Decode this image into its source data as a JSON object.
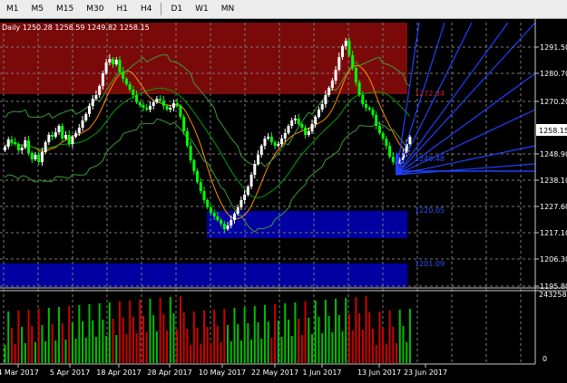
{
  "toolbar": {
    "timeframes": [
      "M1",
      "M5",
      "M15",
      "M30",
      "H1",
      "H4",
      "D1",
      "W1",
      "MN"
    ]
  },
  "chart": {
    "header": "Daily  1250.28 1258.59 1249.82 1258.15",
    "price_axis": [
      "1291.50",
      "1280.70",
      "1270.20",
      "1258.15",
      "1248.90",
      "1238.10",
      "1227.60",
      "1217.10",
      "1206.30",
      "1195.80"
    ],
    "current_price": "1258.15",
    "zone_labels": [
      "1272.84",
      "1249.48",
      "1220.05",
      "1201.09"
    ],
    "volume_axis": [
      "243258",
      "0"
    ],
    "date_axis": [
      "4 Mar 2017",
      "5 Apr 2017",
      "18 Apr 2017",
      "28 Apr 2017",
      "10 May 2017",
      "22 May 2017",
      "1 Jun 2017",
      "13 Jun 2017",
      "23 Jun 2017"
    ],
    "colors": {
      "bull": "#ffffff",
      "bear": "#00ff00",
      "resistance_zone": "#7a0a0a",
      "support_zone": "#0000a0",
      "fan": "#2040ff",
      "ma_fast": "#ff8c00",
      "ma_slow": "#00a000",
      "bands": "#3c9a3c",
      "vol_up": "#00c000",
      "vol_down": "#d00000"
    }
  }
}
